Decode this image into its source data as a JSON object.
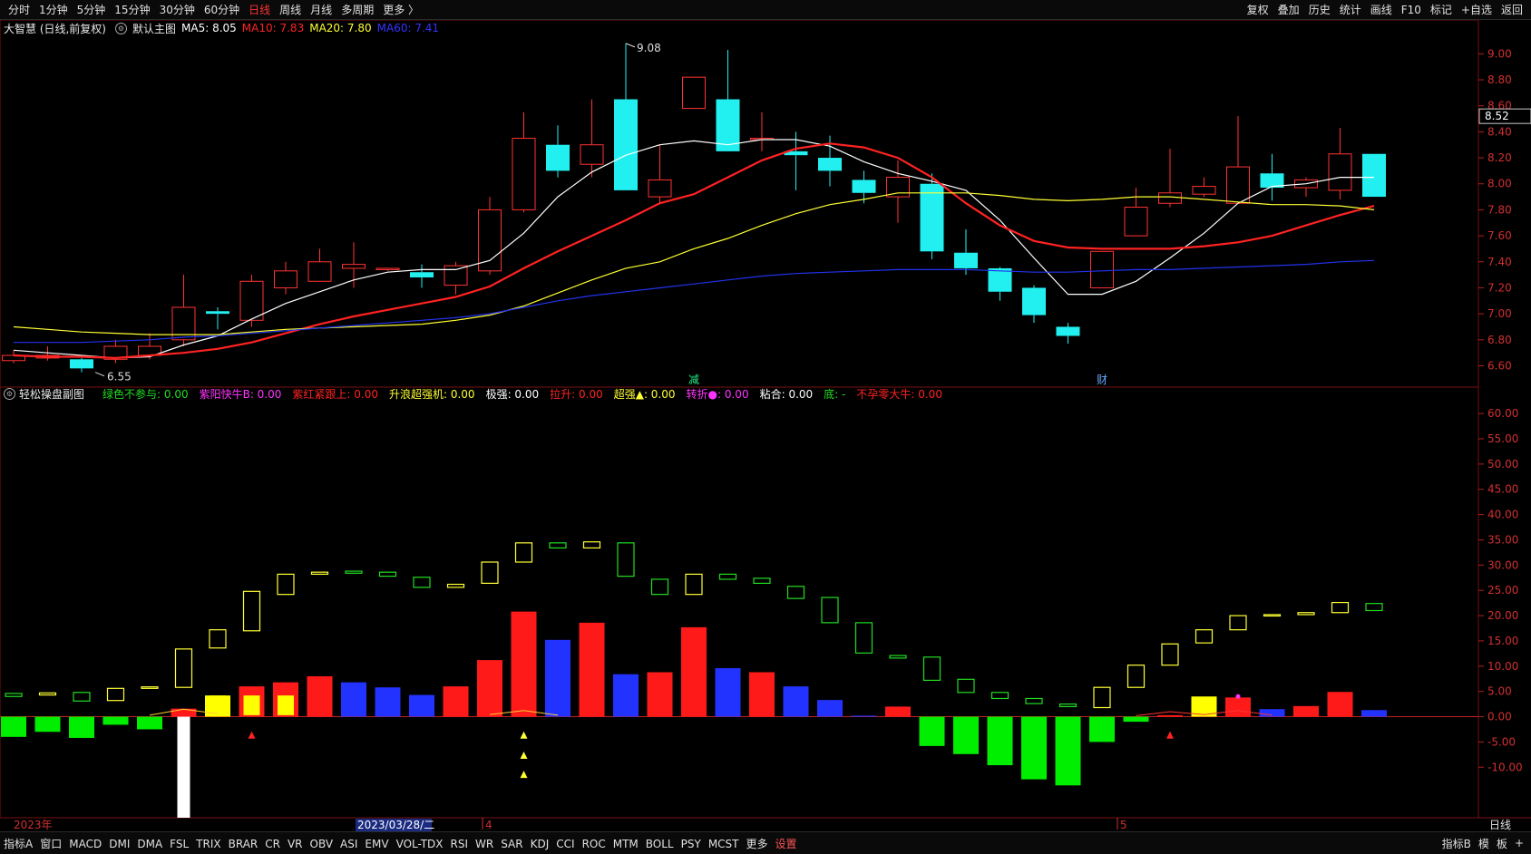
{
  "toolbar": {
    "periods": [
      "分时",
      "1分钟",
      "5分钟",
      "15分钟",
      "30分钟",
      "60分钟",
      "日线",
      "周线",
      "月线",
      "多周期",
      "更多 〉"
    ],
    "active_period": "日线",
    "right_items": [
      "复权",
      "叠加",
      "历史",
      "统计",
      "画线",
      "F10",
      "标记",
      "+自选",
      "返回"
    ]
  },
  "main_legend": {
    "title": "大智慧 (日线,前复权)",
    "main_label": "默认主图",
    "ma": [
      {
        "label": "MA5: 8.05",
        "color": "#ffffff"
      },
      {
        "label": "MA10: 7.83",
        "color": "#ff2222"
      },
      {
        "label": "MA20: 7.80",
        "color": "#ffff33"
      },
      {
        "label": "MA60: 7.41",
        "color": "#3333ff"
      }
    ]
  },
  "sub_legend": {
    "title": "轻松操盘副图",
    "items": [
      {
        "label": "绿色不参与: 0.00",
        "color": "#22dd22"
      },
      {
        "label": "紫阳快牛B: 0.00",
        "color": "#ff33ff"
      },
      {
        "label": "紫红紧跟上: 0.00",
        "color": "#ff2222"
      },
      {
        "label": "升浪超强机: 0.00",
        "color": "#ffff33"
      },
      {
        "label": "极强: 0.00",
        "color": "#ffffff"
      },
      {
        "label": "拉升: 0.00",
        "color": "#ff2222"
      },
      {
        "label": "超强▲: 0.00",
        "color": "#ffff33"
      },
      {
        "label": "转折●: 0.00",
        "color": "#ff33ff"
      },
      {
        "label": "粘合: 0.00",
        "color": "#ffffff"
      },
      {
        "label": "底: -",
        "color": "#22dd22"
      },
      {
        "label": "不孕零大牛: 0.00",
        "color": "#ff2222"
      }
    ]
  },
  "bottom_tabs": [
    "指标A",
    "窗口",
    "MACD",
    "DMI",
    "DMA",
    "FSL",
    "TRIX",
    "BRAR",
    "CR",
    "VR",
    "OBV",
    "ASI",
    "EMV",
    "VOL-TDX",
    "RSI",
    "WR",
    "SAR",
    "KDJ",
    "CCI",
    "ROC",
    "MTM",
    "BOLL",
    "PSY",
    "MCST",
    "更多",
    "设置"
  ],
  "bottom_right": [
    "指标B",
    "模",
    "板",
    "+"
  ],
  "axis_bottom": {
    "year": "2023年",
    "cursor_date": "2023/03/28/二",
    "month4": "4",
    "month5": "5",
    "period": "日线"
  },
  "markers": {
    "high_label": "9.08",
    "low_label": "6.55",
    "price_tag": "8.52",
    "event_1": "减",
    "event_2": "财"
  },
  "chart_data": [
    {
      "type": "candlestick",
      "ylim": [
        6.45,
        9.1
      ],
      "yticks": [
        6.6,
        6.8,
        7.0,
        7.2,
        7.4,
        7.6,
        7.8,
        8.0,
        8.2,
        8.4,
        8.6,
        8.8,
        9.0
      ],
      "candles": [
        {
          "o": 6.64,
          "h": 6.72,
          "l": 6.62,
          "c": 6.68
        },
        {
          "o": 6.66,
          "h": 6.75,
          "l": 6.64,
          "c": 6.68
        },
        {
          "o": 6.65,
          "h": 6.66,
          "l": 6.55,
          "c": 6.58
        },
        {
          "o": 6.65,
          "h": 6.8,
          "l": 6.62,
          "c": 6.75
        },
        {
          "o": 6.68,
          "h": 6.85,
          "l": 6.65,
          "c": 6.75
        },
        {
          "o": 6.8,
          "h": 7.3,
          "l": 6.75,
          "c": 7.05
        },
        {
          "o": 7.02,
          "h": 7.05,
          "l": 6.88,
          "c": 7.0
        },
        {
          "o": 6.95,
          "h": 7.3,
          "l": 6.9,
          "c": 7.25
        },
        {
          "o": 7.2,
          "h": 7.4,
          "l": 7.15,
          "c": 7.33
        },
        {
          "o": 7.25,
          "h": 7.5,
          "l": 7.25,
          "c": 7.4
        },
        {
          "o": 7.35,
          "h": 7.55,
          "l": 7.2,
          "c": 7.38
        },
        {
          "o": 7.35,
          "h": 7.35,
          "l": 7.33,
          "c": 7.35
        },
        {
          "o": 7.32,
          "h": 7.38,
          "l": 7.2,
          "c": 7.28
        },
        {
          "o": 7.22,
          "h": 7.4,
          "l": 7.15,
          "c": 7.37
        },
        {
          "o": 7.33,
          "h": 7.9,
          "l": 7.3,
          "c": 7.8
        },
        {
          "o": 7.8,
          "h": 8.55,
          "l": 7.78,
          "c": 8.35
        },
        {
          "o": 8.3,
          "h": 8.45,
          "l": 8.05,
          "c": 8.1
        },
        {
          "o": 8.15,
          "h": 8.65,
          "l": 8.05,
          "c": 8.3
        },
        {
          "o": 8.65,
          "h": 9.08,
          "l": 7.95,
          "c": 7.95
        },
        {
          "o": 7.9,
          "h": 8.3,
          "l": 7.85,
          "c": 8.03
        },
        {
          "o": 8.58,
          "h": 8.82,
          "l": 8.58,
          "c": 8.82
        },
        {
          "o": 8.65,
          "h": 9.03,
          "l": 8.3,
          "c": 8.25
        },
        {
          "o": 8.35,
          "h": 8.55,
          "l": 8.25,
          "c": 8.35
        },
        {
          "o": 8.25,
          "h": 8.4,
          "l": 7.95,
          "c": 8.22
        },
        {
          "o": 8.2,
          "h": 8.37,
          "l": 7.98,
          "c": 8.1
        },
        {
          "o": 8.03,
          "h": 8.1,
          "l": 7.85,
          "c": 7.93
        },
        {
          "o": 7.9,
          "h": 8.18,
          "l": 7.7,
          "c": 8.05
        },
        {
          "o": 8.0,
          "h": 8.08,
          "l": 7.42,
          "c": 7.48
        },
        {
          "o": 7.47,
          "h": 7.65,
          "l": 7.3,
          "c": 7.35
        },
        {
          "o": 7.35,
          "h": 7.36,
          "l": 7.1,
          "c": 7.17
        },
        {
          "o": 7.2,
          "h": 7.22,
          "l": 6.93,
          "c": 6.99
        },
        {
          "o": 6.9,
          "h": 6.93,
          "l": 6.77,
          "c": 6.83
        },
        {
          "o": 7.2,
          "h": 7.48,
          "l": 7.2,
          "c": 7.48
        },
        {
          "o": 7.6,
          "h": 7.97,
          "l": 7.6,
          "c": 7.82
        },
        {
          "o": 7.85,
          "h": 8.27,
          "l": 7.82,
          "c": 7.93
        },
        {
          "o": 7.92,
          "h": 8.05,
          "l": 7.9,
          "c": 7.98
        },
        {
          "o": 7.85,
          "h": 8.52,
          "l": 7.85,
          "c": 8.13
        },
        {
          "o": 8.08,
          "h": 8.23,
          "l": 7.87,
          "c": 7.97
        },
        {
          "o": 7.97,
          "h": 8.05,
          "l": 7.9,
          "c": 8.03
        },
        {
          "o": 7.95,
          "h": 8.43,
          "l": 7.88,
          "c": 8.23
        },
        {
          "o": 8.23,
          "h": 8.23,
          "l": 7.9,
          "c": 7.9
        }
      ],
      "series": [
        {
          "name": "MA5",
          "color": "#ffffff",
          "values": [
            6.72,
            6.7,
            6.68,
            6.66,
            6.67,
            6.76,
            6.83,
            6.96,
            7.08,
            7.17,
            7.26,
            7.32,
            7.34,
            7.34,
            7.41,
            7.62,
            7.9,
            8.09,
            8.22,
            8.3,
            8.33,
            8.3,
            8.34,
            8.34,
            8.29,
            8.17,
            8.08,
            8.02,
            7.95,
            7.72,
            7.43,
            7.15,
            7.15,
            7.25,
            7.43,
            7.62,
            7.85,
            7.98,
            8.0,
            8.05,
            8.05
          ]
        },
        {
          "name": "MA10",
          "color": "#ff2222",
          "values": [
            6.68,
            6.67,
            6.67,
            6.66,
            6.68,
            6.7,
            6.73,
            6.78,
            6.85,
            6.92,
            6.98,
            7.03,
            7.08,
            7.13,
            7.21,
            7.35,
            7.48,
            7.6,
            7.72,
            7.85,
            7.92,
            8.05,
            8.18,
            8.27,
            8.31,
            8.28,
            8.2,
            8.05,
            7.85,
            7.68,
            7.56,
            7.51,
            7.5,
            7.5,
            7.5,
            7.52,
            7.55,
            7.6,
            7.68,
            7.76,
            7.83
          ]
        },
        {
          "name": "MA20",
          "color": "#ffff33",
          "values": [
            6.9,
            6.88,
            6.86,
            6.85,
            6.84,
            6.84,
            6.84,
            6.86,
            6.88,
            6.89,
            6.9,
            6.91,
            6.92,
            6.95,
            6.99,
            7.06,
            7.16,
            7.26,
            7.35,
            7.4,
            7.5,
            7.58,
            7.68,
            7.77,
            7.84,
            7.88,
            7.93,
            7.93,
            7.93,
            7.91,
            7.88,
            7.87,
            7.88,
            7.9,
            7.9,
            7.88,
            7.86,
            7.84,
            7.84,
            7.83,
            7.8
          ]
        },
        {
          "name": "MA60",
          "color": "#2233ee",
          "values": [
            6.78,
            6.78,
            6.78,
            6.79,
            6.8,
            6.82,
            6.83,
            6.85,
            6.87,
            6.89,
            6.91,
            6.93,
            6.95,
            6.97,
            7.0,
            7.05,
            7.1,
            7.14,
            7.17,
            7.2,
            7.23,
            7.26,
            7.29,
            7.31,
            7.32,
            7.33,
            7.34,
            7.34,
            7.34,
            7.33,
            7.32,
            7.32,
            7.33,
            7.34,
            7.34,
            7.35,
            7.36,
            7.37,
            7.38,
            7.4,
            7.41
          ]
        }
      ]
    },
    {
      "type": "bar",
      "ylim": [
        -20,
        62
      ],
      "yticks": [
        -10,
        -5,
        0,
        5,
        10,
        15,
        20,
        25,
        30,
        35,
        40,
        45,
        50,
        55,
        60
      ],
      "bars": [
        {
          "v": -4,
          "c": "#00ee00"
        },
        {
          "v": -3,
          "c": "#00ee00"
        },
        {
          "v": -4.2,
          "c": "#00ee00"
        },
        {
          "v": -1.6,
          "c": "#00ee00"
        },
        {
          "v": -2.5,
          "c": "#00ee00"
        },
        {
          "v": 1.6,
          "c": "#ff1a1a"
        },
        {
          "v": 4.2,
          "c": "#ffff00",
          "w": 2
        },
        {
          "v": 6,
          "c": "#ff1a1a"
        },
        {
          "v": 6.8,
          "c": "#ff1a1a"
        },
        {
          "v": 8,
          "c": "#ff1a1a"
        },
        {
          "v": 6.8,
          "c": "#2233ff"
        },
        {
          "v": 5.8,
          "c": "#2233ff"
        },
        {
          "v": 4.3,
          "c": "#2233ff"
        },
        {
          "v": 6,
          "c": "#ff1a1a"
        },
        {
          "v": 11.2,
          "c": "#ff1a1a"
        },
        {
          "v": 20.8,
          "c": "#ff1a1a"
        },
        {
          "v": 15.2,
          "c": "#2233ff"
        },
        {
          "v": 18.6,
          "c": "#ff1a1a"
        },
        {
          "v": 8.4,
          "c": "#2233ff"
        },
        {
          "v": 8.8,
          "c": "#ff1a1a"
        },
        {
          "v": 17.7,
          "c": "#ff1a1a"
        },
        {
          "v": 9.6,
          "c": "#2233ff"
        },
        {
          "v": 8.8,
          "c": "#ff1a1a"
        },
        {
          "v": 6,
          "c": "#2233ff"
        },
        {
          "v": 3.3,
          "c": "#2233ff"
        },
        {
          "v": 0.2,
          "c": "#2233ff"
        },
        {
          "v": 2,
          "c": "#ff1a1a"
        },
        {
          "v": -5.8,
          "c": "#00ee00"
        },
        {
          "v": -7.4,
          "c": "#00ee00"
        },
        {
          "v": -9.6,
          "c": "#00ee00"
        },
        {
          "v": -12.4,
          "c": "#00ee00"
        },
        {
          "v": -13.6,
          "c": "#00ee00"
        },
        {
          "v": -5.0,
          "c": "#00ee00"
        },
        {
          "v": -1.0,
          "c": "#00ee00"
        },
        {
          "v": 0.3,
          "c": "#ff1a1a"
        },
        {
          "v": 4,
          "c": "#ffff00"
        },
        {
          "v": 3.8,
          "c": "#ff1a1a"
        },
        {
          "v": 1.5,
          "c": "#2233ff"
        },
        {
          "v": 2.1,
          "c": "#ff1a1a"
        },
        {
          "v": 4.9,
          "c": "#ff1a1a"
        },
        {
          "v": 1.3,
          "c": "#2233ff"
        }
      ],
      "white_bar": {
        "index": 5,
        "v": -20
      },
      "boxes": [
        {
          "lo": 4,
          "hi": 4.6,
          "c": "#22dd22"
        },
        {
          "lo": 4.3,
          "hi": 4.7,
          "c": "#ffff33"
        },
        {
          "lo": 3.1,
          "hi": 4.8,
          "c": "#22dd22"
        },
        {
          "lo": 3.2,
          "hi": 5.6,
          "c": "#ffff33"
        },
        {
          "lo": 5.6,
          "hi": 5.9,
          "c": "#ffff33"
        },
        {
          "lo": 5.8,
          "hi": 13.4,
          "c": "#ffff33"
        },
        {
          "lo": 13.6,
          "hi": 17.2,
          "c": "#ffff33"
        },
        {
          "lo": 17,
          "hi": 24.8,
          "c": "#ffff33"
        },
        {
          "lo": 24.2,
          "hi": 28.2,
          "c": "#ffff33"
        },
        {
          "lo": 28.2,
          "hi": 28.6,
          "c": "#ffff33"
        },
        {
          "lo": 28.4,
          "hi": 28.8,
          "c": "#22dd22"
        },
        {
          "lo": 27.8,
          "hi": 28.6,
          "c": "#22dd22"
        },
        {
          "lo": 25.6,
          "hi": 27.6,
          "c": "#22dd22"
        },
        {
          "lo": 25.6,
          "hi": 26.2,
          "c": "#ffff33"
        },
        {
          "lo": 26.4,
          "hi": 30.6,
          "c": "#ffff33"
        },
        {
          "lo": 30.6,
          "hi": 34.4,
          "c": "#ffff33"
        },
        {
          "lo": 33.4,
          "hi": 34.4,
          "c": "#22dd22"
        },
        {
          "lo": 33.4,
          "hi": 34.6,
          "c": "#ffff33"
        },
        {
          "lo": 27.8,
          "hi": 34.4,
          "c": "#22dd22"
        },
        {
          "lo": 24.2,
          "hi": 27.2,
          "c": "#22dd22"
        },
        {
          "lo": 24.2,
          "hi": 28.2,
          "c": "#ffff33"
        },
        {
          "lo": 27.2,
          "hi": 28.2,
          "c": "#22dd22"
        },
        {
          "lo": 26.4,
          "hi": 27.4,
          "c": "#22dd22"
        },
        {
          "lo": 23.4,
          "hi": 25.8,
          "c": "#22dd22"
        },
        {
          "lo": 18.6,
          "hi": 23.6,
          "c": "#22dd22"
        },
        {
          "lo": 12.6,
          "hi": 18.6,
          "c": "#22dd22"
        },
        {
          "lo": 11.6,
          "hi": 12.1,
          "c": "#22dd22"
        },
        {
          "lo": 7.2,
          "hi": 11.8,
          "c": "#22dd22"
        },
        {
          "lo": 4.8,
          "hi": 7.4,
          "c": "#22dd22"
        },
        {
          "lo": 3.6,
          "hi": 4.8,
          "c": "#22dd22"
        },
        {
          "lo": 2.6,
          "hi": 3.6,
          "c": "#22dd22"
        },
        {
          "lo": 2,
          "hi": 2.5,
          "c": "#22dd22"
        },
        {
          "lo": 1.8,
          "hi": 5.8,
          "c": "#ffff33"
        },
        {
          "lo": 5.8,
          "hi": 10.2,
          "c": "#ffff33"
        },
        {
          "lo": 10.2,
          "hi": 14.4,
          "c": "#ffff33"
        },
        {
          "lo": 14.6,
          "hi": 17.2,
          "c": "#ffff33"
        },
        {
          "lo": 17.2,
          "hi": 20,
          "c": "#ffff33"
        },
        {
          "lo": 20,
          "hi": 20.2,
          "c": "#ffff33"
        },
        {
          "lo": 20.2,
          "hi": 20.6,
          "c": "#ffff33"
        },
        {
          "lo": 20.6,
          "hi": 22.6,
          "c": "#ffff33"
        },
        {
          "lo": 21,
          "hi": 22.4,
          "c": "#22dd22"
        }
      ],
      "up_triangles": [
        {
          "i": 7,
          "v": -3.8,
          "c": "#ff2222"
        },
        {
          "i": 15,
          "v": -3.8,
          "c": "#ffff33"
        },
        {
          "i": 15,
          "v": -7.8,
          "c": "#ffff33"
        },
        {
          "i": 15,
          "v": -11.6,
          "c": "#ffff33"
        },
        {
          "i": 34,
          "v": -3.8,
          "c": "#ff2222"
        }
      ]
    }
  ]
}
